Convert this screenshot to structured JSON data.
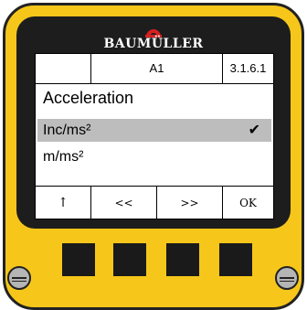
{
  "brand": {
    "name": "BAUMÜLLER"
  },
  "header": {
    "left": "",
    "center": "A1",
    "right": "3.1.6.1"
  },
  "menu": {
    "title": "Acceleration",
    "items": [
      {
        "label": "Inc/ms²",
        "mark": "✔"
      },
      {
        "label": "m/ms²",
        "mark": ""
      }
    ]
  },
  "softkeys": [
    "↑",
    "<<",
    ">>",
    "OK"
  ],
  "colors": {
    "housing": "#f6c71a",
    "bezel": "#1d1d1d",
    "selection": "#bdbdbd"
  }
}
